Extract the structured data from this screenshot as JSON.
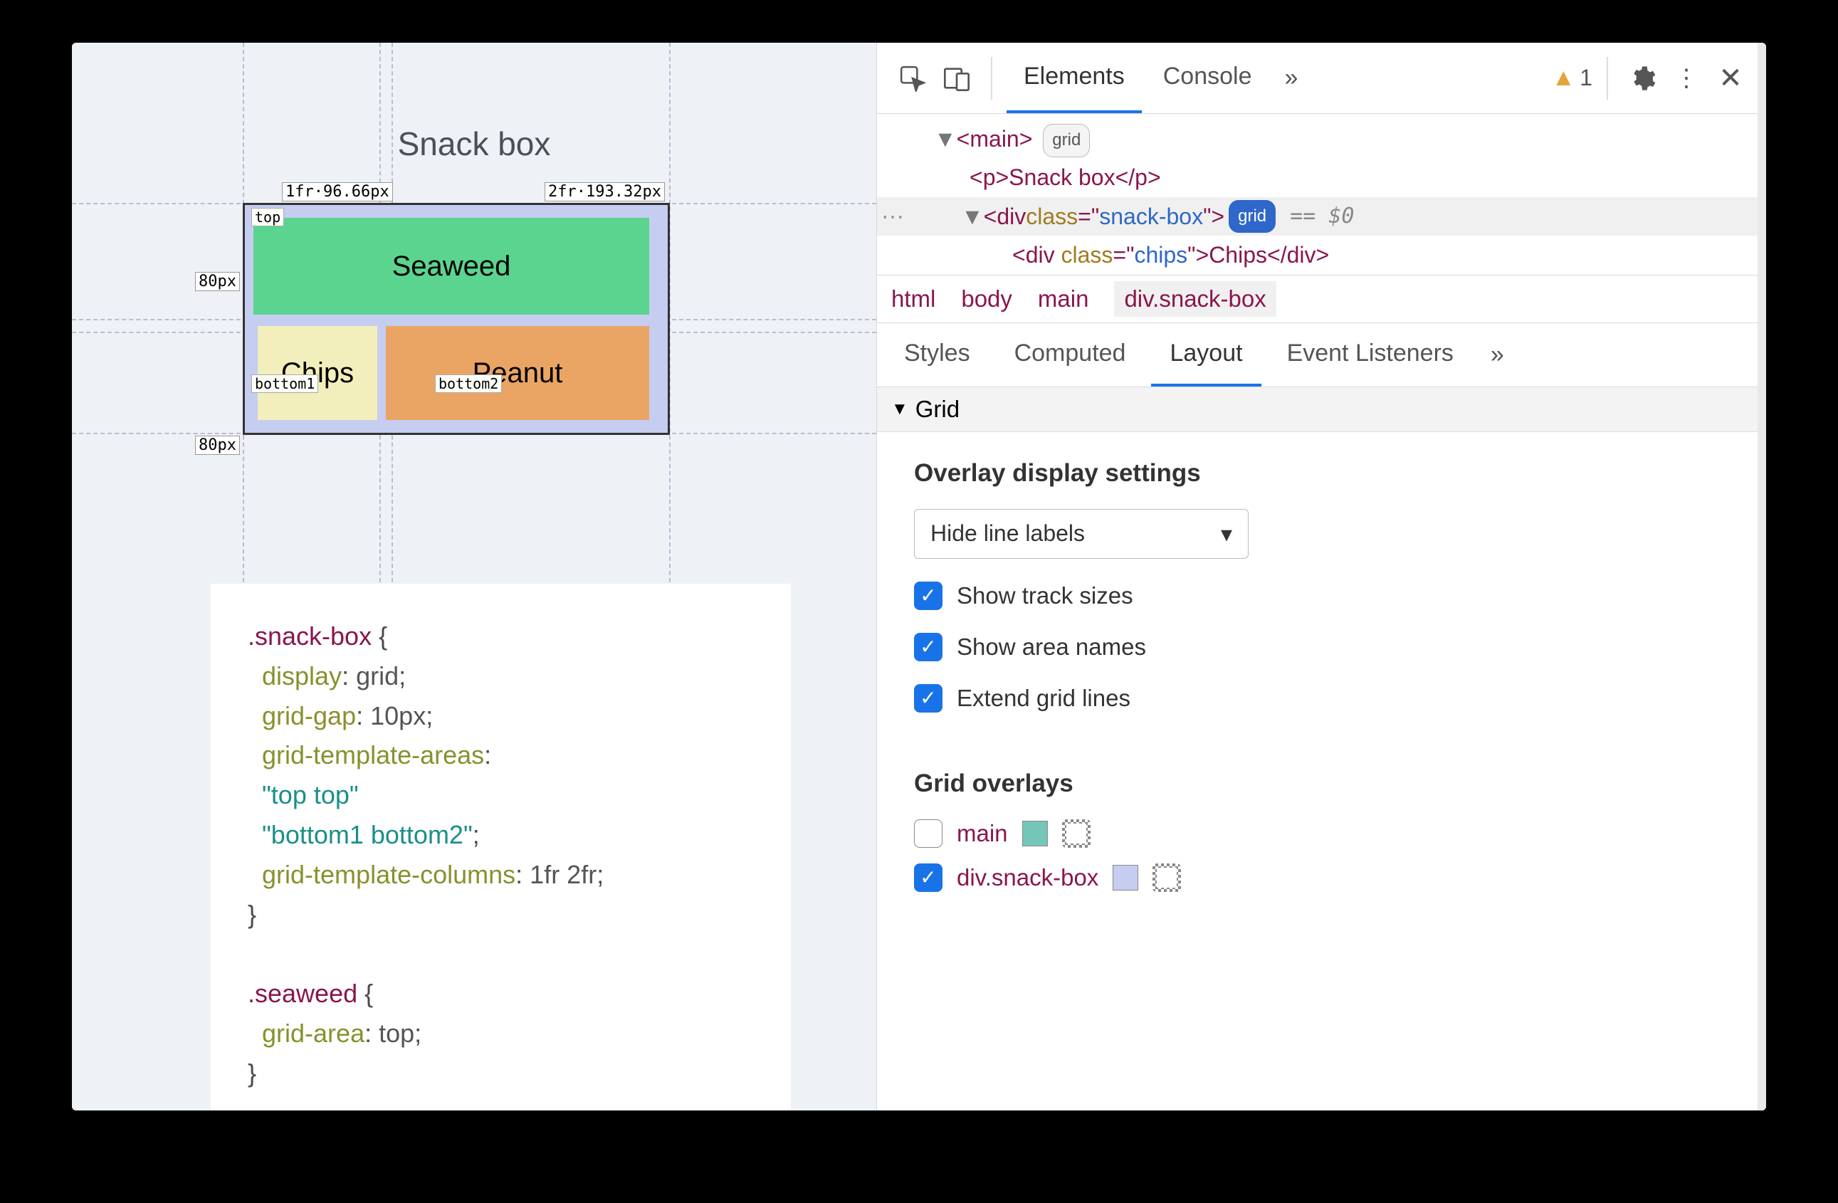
{
  "page": {
    "title": "Snack box",
    "cells": {
      "seaweed": "Seaweed",
      "chips": "Chips",
      "peanut": "Peanut"
    },
    "overlay": {
      "col1": "1fr·96.66px",
      "col2": "2fr·193.32px",
      "row1": "80px",
      "row2": "80px",
      "area_top": "top",
      "area_b1": "bottom1",
      "area_b2": "bottom2"
    },
    "code": {
      "line1_sel": ".snack-box",
      "line2_prop": "display",
      "line2_val": "grid",
      "line3_prop": "grid-gap",
      "line3_val": "10px",
      "line4_prop": "grid-template-areas",
      "line5_str": "\"top top\"",
      "line6_str": "\"bottom1 bottom2\"",
      "line7_prop": "grid-template-columns",
      "line7_val": "1fr 2fr",
      "line9_sel": ".seaweed",
      "line10_prop": "grid-area",
      "line10_val": "top"
    }
  },
  "devtools": {
    "tabs": {
      "elements": "Elements",
      "console": "Console"
    },
    "warn_count": "1",
    "dom": {
      "main_open": "<main>",
      "grid_badge": "grid",
      "p_snack": "<p>Snack box</p>",
      "div_snack_open_a": "<div ",
      "div_snack_class": "class",
      "div_snack_eq": "=\"",
      "div_snack_val": "snack-box",
      "div_snack_close": "\">",
      "eq0": "== $0",
      "chips_a": "<div ",
      "chips_b": "class",
      "chips_c": "=\"",
      "chips_d": "chips",
      "chips_e": "\">Chips</div>"
    },
    "breadcrumb": [
      "html",
      "body",
      "main",
      "div.snack-box"
    ],
    "subtabs": {
      "styles": "Styles",
      "computed": "Computed",
      "layout": "Layout",
      "listeners": "Event Listeners"
    },
    "accordion": "Grid",
    "overlay_settings": {
      "heading": "Overlay display settings",
      "dropdown": "Hide line labels",
      "show_track": "Show track sizes",
      "show_area": "Show area names",
      "extend": "Extend grid lines"
    },
    "grid_overlays": {
      "heading": "Grid overlays",
      "items": [
        {
          "label": "main",
          "checked": false,
          "swatch": "sw-teal"
        },
        {
          "label": "div.snack-box",
          "checked": true,
          "swatch": "sw-lav"
        }
      ]
    }
  }
}
